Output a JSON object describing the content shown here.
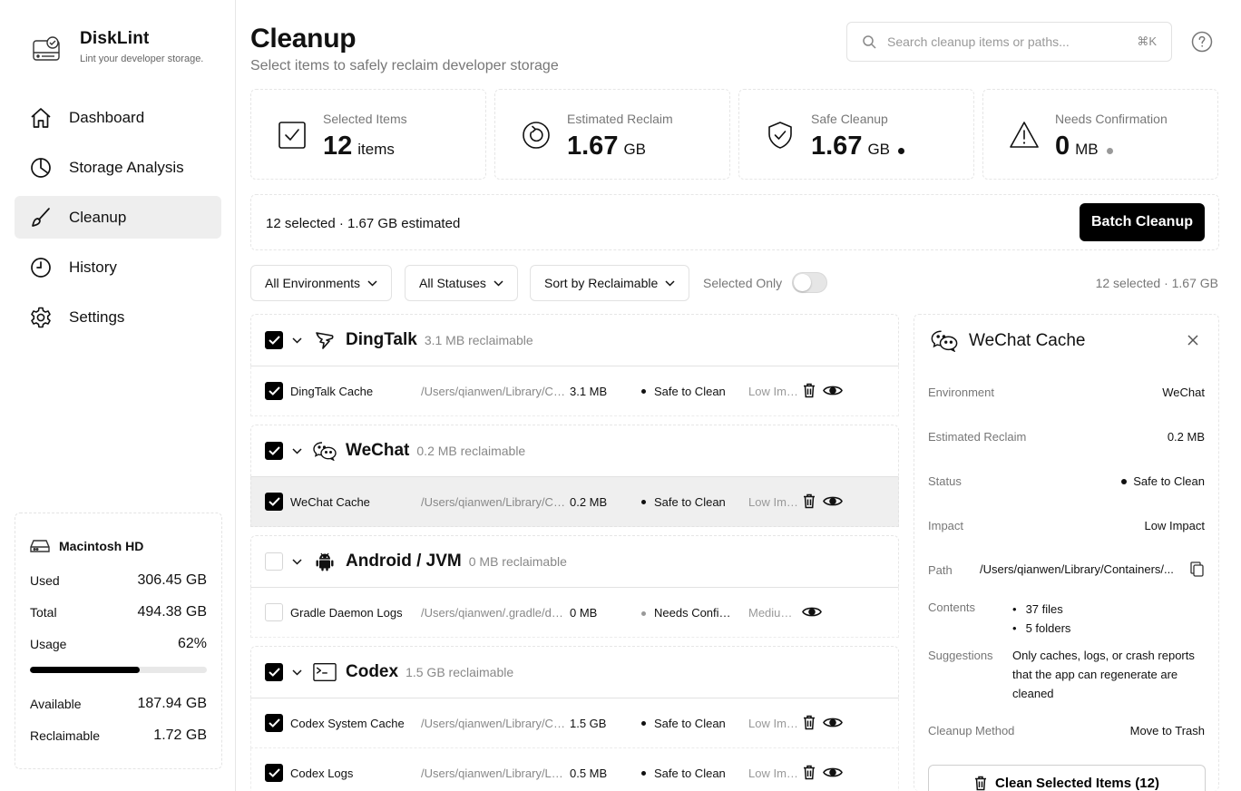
{
  "app": {
    "name": "DiskLint",
    "tagline": "Lint your developer storage."
  },
  "nav": [
    {
      "label": "Dashboard",
      "icon": "home-icon",
      "active": false
    },
    {
      "label": "Storage Analysis",
      "icon": "pie-chart-icon",
      "active": false
    },
    {
      "label": "Cleanup",
      "icon": "brush-icon",
      "active": true
    },
    {
      "label": "History",
      "icon": "clock-icon",
      "active": false
    },
    {
      "label": "Settings",
      "icon": "gear-icon",
      "active": false
    }
  ],
  "disk": {
    "name": "Macintosh HD",
    "used_label": "Used",
    "used": "306.45 GB",
    "total_label": "Total",
    "total": "494.38 GB",
    "usage_label": "Usage",
    "usage": "62%",
    "usage_fraction": 0.62,
    "available_label": "Available",
    "available": "187.94 GB",
    "reclaimable_label": "Reclaimable",
    "reclaimable": "1.72 GB"
  },
  "header": {
    "title": "Cleanup",
    "subtitle": "Select items to safely reclaim developer storage",
    "search_placeholder": "Search cleanup items or paths...",
    "search_shortcut": "⌘K"
  },
  "stats": [
    {
      "label": "Selected Items",
      "value": "12",
      "unit": "items",
      "icon": "checkbox-icon",
      "dot": null
    },
    {
      "label": "Estimated Reclaim",
      "value": "1.67",
      "unit": "GB",
      "icon": "refresh-icon",
      "dot": null
    },
    {
      "label": "Safe Cleanup",
      "value": "1.67",
      "unit": "GB",
      "icon": "shield-check-icon",
      "dot": "#111111"
    },
    {
      "label": "Needs Confirmation",
      "value": "0",
      "unit": "MB",
      "icon": "warning-icon",
      "dot": "#999999"
    }
  ],
  "batch": {
    "summary": "12 selected · 1.67 GB estimated",
    "button": "Batch Cleanup"
  },
  "filters": {
    "environments": "All Environments",
    "statuses": "All Statuses",
    "sort": "Sort by Reclaimable",
    "selected_only_label": "Selected Only",
    "selected_only": false,
    "summary": "12 selected · 1.67 GB"
  },
  "groups": [
    {
      "name": "DingTalk",
      "reclaimable": "3.1 MB reclaimable",
      "checked": true,
      "icon": "dingtalk-icon",
      "items": [
        {
          "name": "DingTalk Cache",
          "path": "/Users/qianwen/Library/Containers/DingTalk",
          "size": "3.1 MB",
          "status": "Safe to Clean",
          "status_kind": "safe",
          "impact": "Low Impact",
          "checked": true,
          "selected": false
        }
      ]
    },
    {
      "name": "WeChat",
      "reclaimable": "0.2 MB reclaimable",
      "checked": true,
      "icon": "wechat-icon",
      "items": [
        {
          "name": "WeChat Cache",
          "path": "/Users/qianwen/Library/Containers/WeChat",
          "size": "0.2 MB",
          "status": "Safe to Clean",
          "status_kind": "safe",
          "impact": "Low Impact",
          "checked": true,
          "selected": true
        }
      ]
    },
    {
      "name": "Android / JVM",
      "reclaimable": "0 MB reclaimable",
      "checked": false,
      "icon": "android-icon",
      "items": [
        {
          "name": "Gradle Daemon Logs",
          "path": "/Users/qianwen/.gradle/daemon",
          "size": "0 MB",
          "status": "Needs Confirmation",
          "status_kind": "confirm",
          "impact": "Medium Impact",
          "checked": false,
          "selected": false
        }
      ]
    },
    {
      "name": "Codex",
      "reclaimable": "1.5 GB reclaimable",
      "checked": true,
      "icon": "terminal-icon",
      "items": [
        {
          "name": "Codex System Cache",
          "path": "/Users/qianwen/Library/Caches/Codex",
          "size": "1.5 GB",
          "status": "Safe to Clean",
          "status_kind": "safe",
          "impact": "Low Impact",
          "checked": true,
          "selected": false
        },
        {
          "name": "Codex Logs",
          "path": "/Users/qianwen/Library/Logs/Codex",
          "size": "0.5 MB",
          "status": "Safe to Clean",
          "status_kind": "safe",
          "impact": "Low Impact",
          "checked": true,
          "selected": false
        }
      ]
    }
  ],
  "detail": {
    "title": "WeChat Cache",
    "environment_label": "Environment",
    "environment": "WeChat",
    "reclaim_label": "Estimated Reclaim",
    "reclaim": "0.2 MB",
    "status_label": "Status",
    "status": "Safe to Clean",
    "impact_label": "Impact",
    "impact": "Low Impact",
    "path_label": "Path",
    "path": "/Users/qianwen/Library/Containers/...",
    "contents_label": "Contents",
    "contents": [
      "37 files",
      "5 folders"
    ],
    "suggestions_label": "Suggestions",
    "suggestions": "Only caches, logs, or crash reports that the app can regenerate are cleaned",
    "method_label": "Cleanup Method",
    "method": "Move to Trash",
    "clean_button": "Clean Selected Items (12)"
  }
}
